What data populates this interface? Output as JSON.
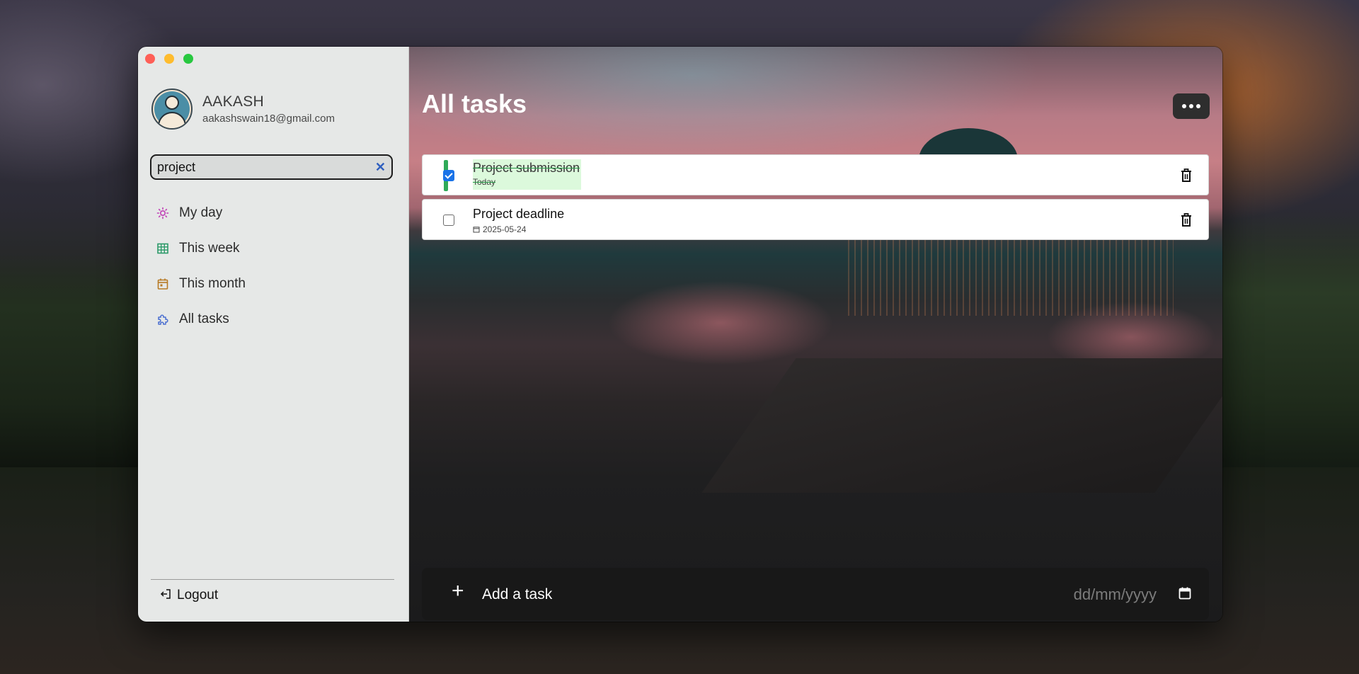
{
  "user": {
    "name": "AAKASH",
    "email": "aakashswain18@gmail.com"
  },
  "search": {
    "value": "project",
    "clear_label": "✕"
  },
  "nav": {
    "items": [
      {
        "label": "My day",
        "icon": "sun-icon",
        "color": "#c03fb6"
      },
      {
        "label": "This week",
        "icon": "grid-icon",
        "color": "#2e9a6a"
      },
      {
        "label": "This month",
        "icon": "calendar-icon",
        "color": "#b77a24"
      },
      {
        "label": "All tasks",
        "icon": "puzzle-icon",
        "color": "#4b6fd0"
      }
    ]
  },
  "logout": {
    "label": "Logout",
    "icon": "logout-icon"
  },
  "main": {
    "title": "All tasks",
    "more_icon": "ellipsis-icon"
  },
  "tasks": [
    {
      "name": "Project submission",
      "date": "Today",
      "completed": true
    },
    {
      "name": "Project deadline",
      "date": "2025-05-24",
      "completed": false
    }
  ],
  "add_task": {
    "plus": "+",
    "label": "Add a task",
    "date_placeholder": "dd/mm/yyyy"
  },
  "colors": {
    "sidebar_bg": "#e6e8e7",
    "done_highlight": "#dcf9dc",
    "done_bar": "#2faa58",
    "checkbox_checked": "#1a73e8"
  }
}
